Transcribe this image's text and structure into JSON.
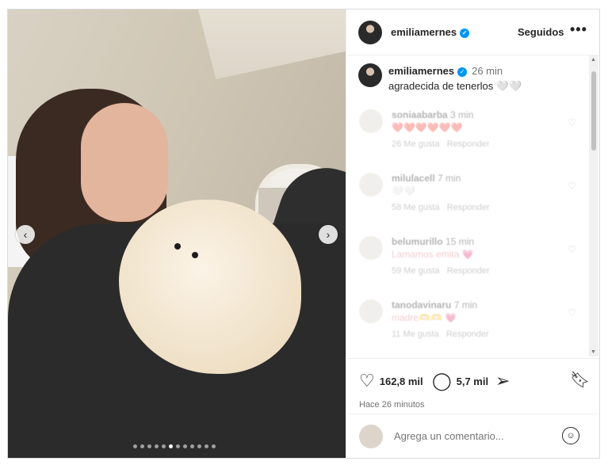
{
  "post": {
    "author": "emiliamernes",
    "follow_label": "Seguidos",
    "more_label": "•••",
    "caption_time": "26 min",
    "caption": "agradecida de tenerlos 🤍🤍",
    "likes": "162,8 mil",
    "comment_count": "5,7 mil",
    "posted_ago": "Hace 26 minutos"
  },
  "carousel": {
    "prev": "‹",
    "next": "›",
    "dot_count": 12,
    "active_dot": 5
  },
  "comments": [
    {
      "user": "soniaabarba",
      "time": "3 min",
      "text": "❤️❤️❤️❤️❤️❤️",
      "likes": "26 Me gusta",
      "reply": "Responder"
    },
    {
      "user": "milulacell",
      "time": "7 min",
      "text": "🤍🤍",
      "likes": "58 Me gusta",
      "reply": "Responder"
    },
    {
      "user": "belumurillo",
      "time": "15 min",
      "text": "Lamamos emita 💗",
      "likes": "59 Me gusta",
      "reply": "Responder"
    },
    {
      "user": "tanodavinaru",
      "time": "7 min",
      "text": "madre🫶🫶 💗",
      "likes": "11 Me gusta",
      "reply": "Responder"
    }
  ],
  "add_comment": {
    "placeholder": "Agrega un comentario..."
  },
  "icons": {
    "heart": "heart-icon",
    "comment": "comment-icon",
    "share": "share-icon",
    "bookmark": "bookmark-icon",
    "emoji": "emoji-icon"
  },
  "colors": {
    "verified": "#0095f6",
    "muted": "#737373"
  }
}
